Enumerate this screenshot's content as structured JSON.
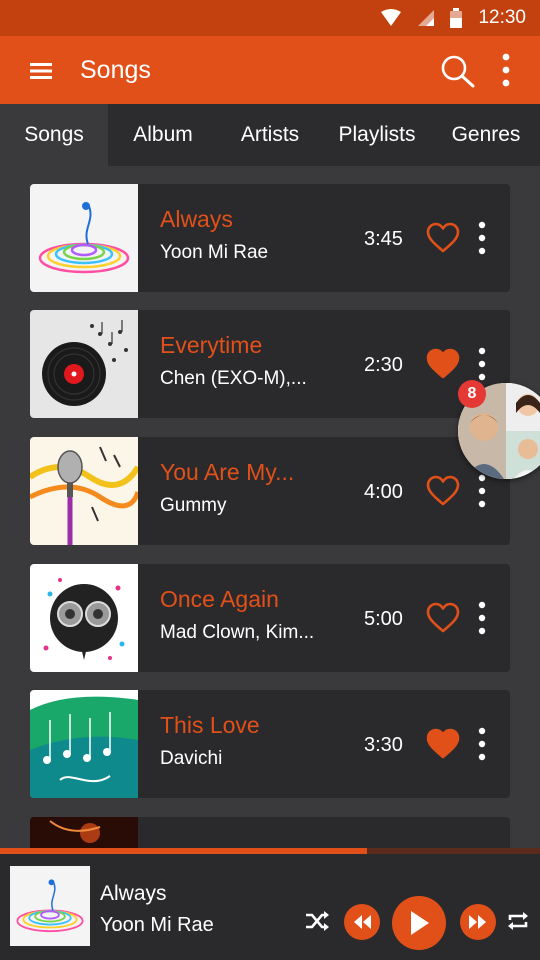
{
  "status_bar": {
    "time": "12:30"
  },
  "app_bar": {
    "title": "Songs"
  },
  "tabs": [
    {
      "label": "Songs",
      "active": true
    },
    {
      "label": "Album",
      "active": false
    },
    {
      "label": "Artists",
      "active": false
    },
    {
      "label": "Playlists",
      "active": false
    },
    {
      "label": "Genres",
      "active": false
    }
  ],
  "songs": [
    {
      "title": "Always",
      "artist": "Yoon Mi Rae",
      "duration": "3:45",
      "favorite": false,
      "art": "rainbow-swirl"
    },
    {
      "title": "Everytime",
      "artist": "Chen (EXO-M),...",
      "duration": "2:30",
      "favorite": true,
      "art": "vinyl-record"
    },
    {
      "title": "You Are My...",
      "artist": "Gummy",
      "duration": "4:00",
      "favorite": false,
      "art": "microphone"
    },
    {
      "title": "Once Again",
      "artist": "Mad Clown, Kim...",
      "duration": "5:00",
      "favorite": false,
      "art": "speakers"
    },
    {
      "title": "This Love",
      "artist": "Davichi",
      "duration": "3:30",
      "favorite": true,
      "art": "green-notes"
    }
  ],
  "chat_head": {
    "badge": "8"
  },
  "now_playing": {
    "title": "Always",
    "artist": "Yoon Mi Rae",
    "progress": 0.68
  },
  "colors": {
    "accent": "#e2501a",
    "status_bar": "#c2410f",
    "background": "#3a3a3c",
    "card": "#2a2a2c"
  }
}
